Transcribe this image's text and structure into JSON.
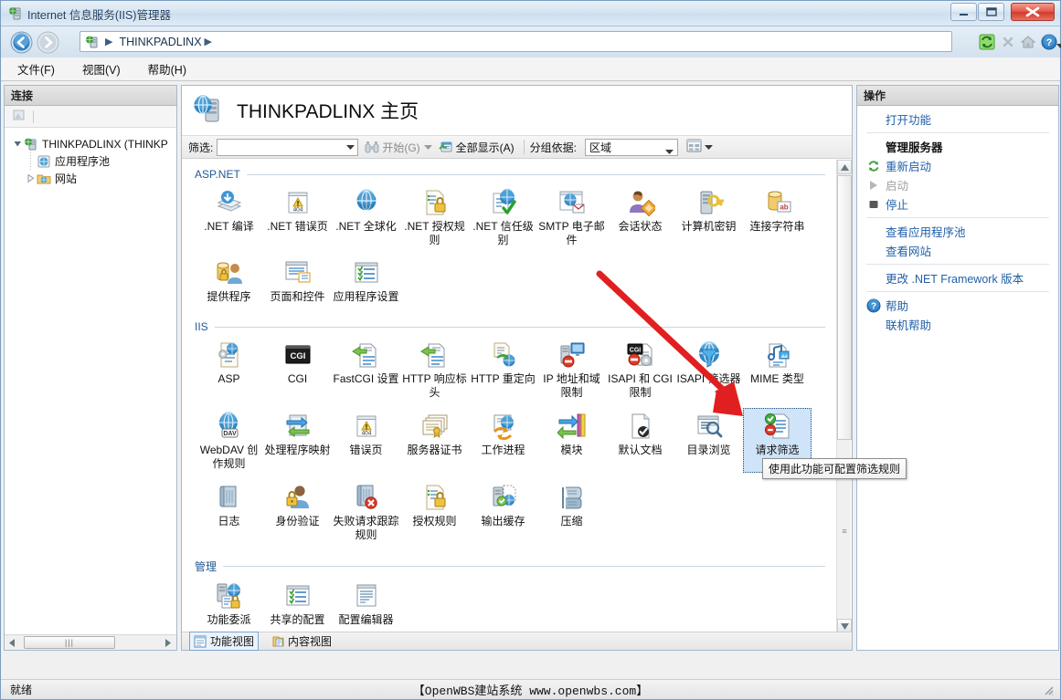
{
  "window": {
    "title": "Internet 信息服务(IIS)管理器",
    "title_icon": "iis-server-icon",
    "minimize_label": "最小化",
    "maximize_label": "最大化",
    "close_label": "关闭"
  },
  "addressbar": {
    "back_label": "后退",
    "forward_label": "前进",
    "crumb_icon": "server-icon",
    "crumb_text": "THINKPADLINX",
    "crumb_separator": "▶",
    "refresh_label": "刷新",
    "stop_label": "停止",
    "home_label": "主页",
    "help_label": "帮助"
  },
  "menubar": {
    "items": [
      {
        "label": "文件(F)"
      },
      {
        "label": "视图(V)"
      },
      {
        "label": "帮助(H)"
      }
    ]
  },
  "left_pane": {
    "header": "连接",
    "toolbar_icon": "connection-toolbar-icon",
    "tree": [
      {
        "label": "THINKPADLINX (THINKP",
        "icon": "server-icon",
        "level": 1,
        "expanded": true
      },
      {
        "label": "应用程序池",
        "icon": "app-pool-icon",
        "level": 2,
        "expanded": false
      },
      {
        "label": "网站",
        "icon": "sites-folder-icon",
        "level": 2,
        "expanded": false
      }
    ],
    "hscroll_grip": "|||"
  },
  "center_pane": {
    "title": "THINKPADLINX 主页",
    "title_icon": "server-home-icon",
    "filter": {
      "label": "筛选:",
      "value": "",
      "placeholder": "",
      "go_label": "开始(G)",
      "go_icon": "binoculars-icon",
      "showall_label": "全部显示(A)",
      "showall_icon": "show-all-icon",
      "groupby_label": "分组依据:",
      "groupby_value": "区域",
      "view_icon": "view-mode-icon"
    },
    "groups": [
      {
        "name": "ASP.NET",
        "rows": [
          [
            {
              "label": ".NET 编译",
              "icon": "net-compilation-icon"
            },
            {
              "label": ".NET 错误页",
              "icon": "net-error-pages-icon"
            },
            {
              "label": ".NET 全球化",
              "icon": "net-globalization-icon"
            },
            {
              "label": ".NET 授权规则",
              "icon": "net-authorization-rules-icon"
            },
            {
              "label": ".NET 信任级别",
              "icon": "net-trust-levels-icon"
            },
            {
              "label": "SMTP 电子邮件",
              "icon": "smtp-email-icon"
            },
            {
              "label": "会话状态",
              "icon": "session-state-icon"
            },
            {
              "label": "计算机密钥",
              "icon": "machine-key-icon"
            },
            {
              "label": "连接字符串",
              "icon": "connection-strings-icon"
            }
          ],
          [
            {
              "label": "提供程序",
              "icon": "providers-icon"
            },
            {
              "label": "页面和控件",
              "icon": "pages-and-controls-icon"
            },
            {
              "label": "应用程序设置",
              "icon": "application-settings-icon"
            }
          ]
        ]
      },
      {
        "name": "IIS",
        "rows": [
          [
            {
              "label": "ASP",
              "icon": "asp-icon"
            },
            {
              "label": "CGI",
              "icon": "cgi-icon"
            },
            {
              "label": "FastCGI 设置",
              "icon": "fastcgi-settings-icon"
            },
            {
              "label": "HTTP 响应标头",
              "icon": "http-response-headers-icon"
            },
            {
              "label": "HTTP 重定向",
              "icon": "http-redirect-icon"
            },
            {
              "label": "IP 地址和域限制",
              "icon": "ip-address-domain-restrictions-icon"
            },
            {
              "label": "ISAPI 和 CGI 限制",
              "icon": "isapi-cgi-restrictions-icon"
            },
            {
              "label": "ISAPI 筛选器",
              "icon": "isapi-filters-icon"
            },
            {
              "label": "MIME 类型",
              "icon": "mime-types-icon"
            }
          ],
          [
            {
              "label": "WebDAV 创作规则",
              "icon": "webdav-authoring-rules-icon"
            },
            {
              "label": "处理程序映射",
              "icon": "handler-mappings-icon"
            },
            {
              "label": "错误页",
              "icon": "error-pages-icon"
            },
            {
              "label": "服务器证书",
              "icon": "server-certificates-icon"
            },
            {
              "label": "工作进程",
              "icon": "worker-processes-icon"
            },
            {
              "label": "模块",
              "icon": "modules-icon"
            },
            {
              "label": "默认文档",
              "icon": "default-document-icon"
            },
            {
              "label": "目录浏览",
              "icon": "directory-browsing-icon"
            },
            {
              "label": "请求筛选",
              "icon": "request-filtering-icon",
              "selected": true
            }
          ],
          [
            {
              "label": "日志",
              "icon": "logging-icon"
            },
            {
              "label": "身份验证",
              "icon": "authentication-icon"
            },
            {
              "label": "失败请求跟踪规则",
              "icon": "failed-request-tracing-rules-icon"
            },
            {
              "label": "授权规则",
              "icon": "authorization-rules-icon"
            },
            {
              "label": "输出缓存",
              "icon": "output-caching-icon"
            },
            {
              "label": "压缩",
              "icon": "compression-icon"
            }
          ]
        ]
      },
      {
        "name": "管理",
        "rows": [
          [
            {
              "label": "功能委派",
              "icon": "feature-delegation-icon"
            },
            {
              "label": "共享的配置",
              "icon": "shared-configuration-icon"
            },
            {
              "label": "配置编辑器",
              "icon": "configuration-editor-icon"
            }
          ]
        ]
      }
    ],
    "tooltip": "使用此功能可配置筛选规则",
    "view_tabs": [
      {
        "label": "功能视图",
        "icon": "features-view-icon",
        "active": true
      },
      {
        "label": "内容视图",
        "icon": "content-view-icon",
        "active": false
      }
    ]
  },
  "right_pane": {
    "header": "操作",
    "actions": [
      {
        "label": "打开功能",
        "icon": "",
        "state": "link",
        "sep_after": true
      },
      {
        "label": "管理服务器",
        "icon": "",
        "state": "header"
      },
      {
        "label": "重新启动",
        "icon": "restart-icon",
        "state": "link"
      },
      {
        "label": "启动",
        "icon": "start-icon",
        "state": "disabled"
      },
      {
        "label": "停止",
        "icon": "stop-icon",
        "state": "link",
        "sep_after": true
      },
      {
        "label": "查看应用程序池",
        "icon": "",
        "state": "link"
      },
      {
        "label": "查看网站",
        "icon": "",
        "state": "link",
        "sep_after": true
      },
      {
        "label": "更改 .NET Framework 版本",
        "icon": "",
        "state": "link",
        "sep_after": true
      },
      {
        "label": "帮助",
        "icon": "help-icon",
        "state": "link"
      },
      {
        "label": "联机帮助",
        "icon": "",
        "state": "link"
      }
    ]
  },
  "statusbar": {
    "text": "就绪",
    "watermark": "【OpenWBS建站系统 www.openwbs.com】",
    "grip_icon": "resize-grip-icon"
  },
  "colors": {
    "accent_blue": "#1f5fa8",
    "group_heading": "#215a92",
    "selection_bg": "#cfe4f8",
    "annotation_red": "#e02020",
    "title_bar": "#d6e4f0"
  }
}
